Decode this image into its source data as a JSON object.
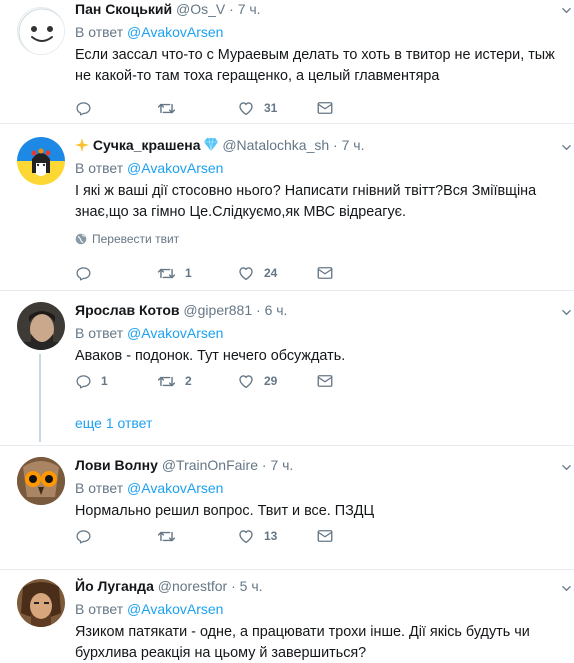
{
  "tweets": [
    {
      "name": "Пан Скоцький",
      "handle": "@Os_V",
      "time": "7 ч.",
      "reply_prefix": "В ответ",
      "reply_to": "@AvakovArsen",
      "text": "Если засcал что-то с Мураевым делать то хоть в твитор не истери, тыж не какой-то там тоха геращенко, а целый главментяра",
      "replies": "",
      "retweets": "",
      "likes": "31"
    },
    {
      "name": "Сучка_крашена",
      "handle": "@Natalochka_sh",
      "time": "7 ч.",
      "reply_prefix": "В ответ",
      "reply_to": "@AvakovArsen",
      "text": "І які ж ваші дії стосовно нього? Написати гнівний твітт?Вся Зміївщіна знає,що за гімно Це.Слідкуємо,як МВС відреагує.",
      "translate": "Перевести твит",
      "replies": "",
      "retweets": "1",
      "likes": "24"
    },
    {
      "name": "Ярослав Котов",
      "handle": "@giper881",
      "time": "6 ч.",
      "reply_prefix": "В ответ",
      "reply_to": "@AvakovArsen",
      "text": "Аваков - подонок. Тут нечего обсуждать.",
      "replies": "1",
      "retweets": "2",
      "likes": "29",
      "more_replies": "еще 1 ответ"
    },
    {
      "name": "Лови Волну",
      "handle": "@TrainOnFaire",
      "time": "7 ч.",
      "reply_prefix": "В ответ",
      "reply_to": "@AvakovArsen",
      "text": "Нормально решил вопрос. Твит и все. ПЗДЦ",
      "replies": "",
      "retweets": "",
      "likes": "13"
    },
    {
      "name": "Йо Луганда",
      "handle": "@norestfor",
      "time": "5 ч.",
      "reply_prefix": "В ответ",
      "reply_to": "@AvakovArsen",
      "text": "Язиком патякати - одне, а працювати трохи інше. Дії якісь будуть чи бурхлива реакція на цьому й завершиться?"
    }
  ],
  "colors": {
    "link": "#1da1f2",
    "muted": "#657786",
    "border": "#e6ecf0"
  },
  "icons": [
    "reply-icon",
    "retweet-icon",
    "like-icon",
    "dm-icon",
    "chevron-down-icon",
    "globe-icon",
    "sparkle-icon",
    "gem-icon"
  ]
}
